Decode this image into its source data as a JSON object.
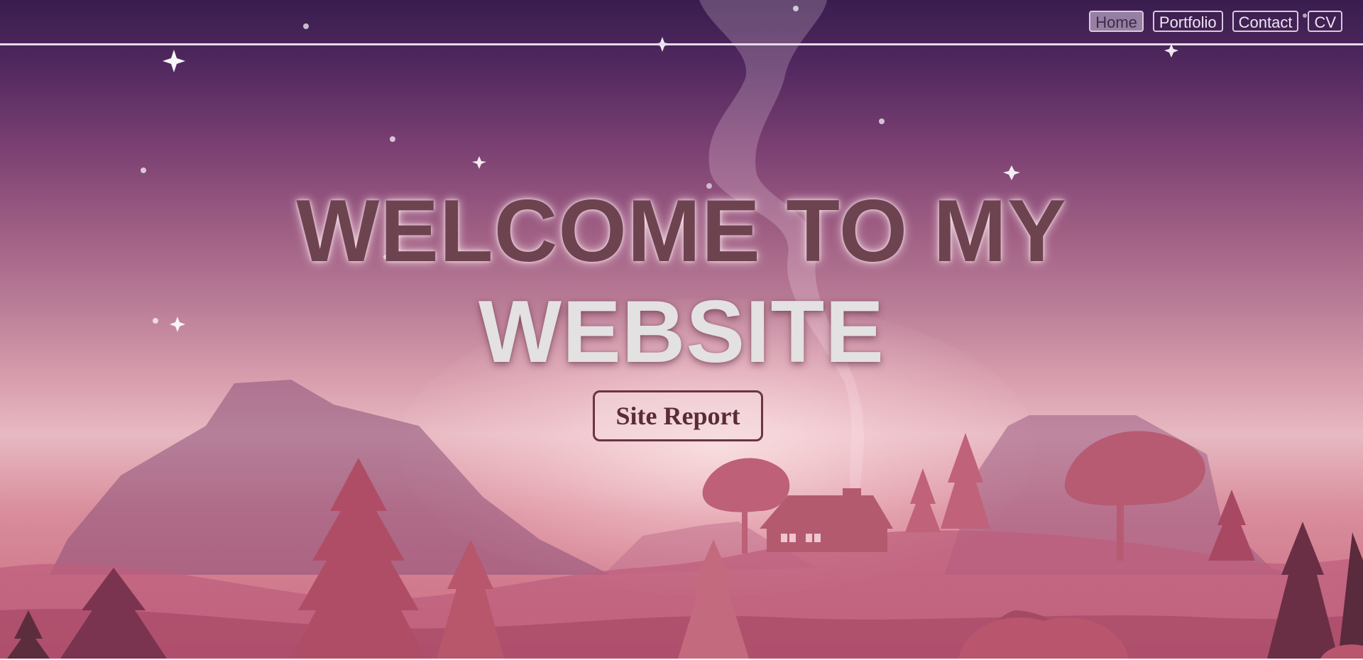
{
  "nav": {
    "links": [
      {
        "label": "Home",
        "active": true
      },
      {
        "label": "Portfolio",
        "active": false
      },
      {
        "label": "Contact",
        "active": false
      },
      {
        "label": "CV",
        "active": false
      }
    ]
  },
  "hero": {
    "title_line1": "WELCOME TO MY",
    "title_line2": "WEBSITE",
    "cta_label": "Site Report"
  },
  "colors": {
    "sky_top": "#3a1d4f",
    "horizon": "#e7b9c2",
    "title_dark": "#6e4350",
    "title_light": "#e3e1e2",
    "button_border": "#6a3540",
    "nav_rule": "#e6dcea"
  }
}
